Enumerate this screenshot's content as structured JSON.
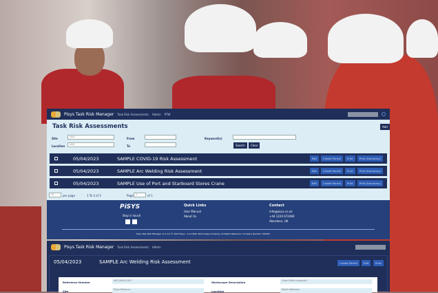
{
  "app": {
    "name": "Pisys Task Risk Manager",
    "nav": [
      "Task Risk Assessments",
      "Admin",
      "PTW"
    ]
  },
  "list": {
    "title": "Task Risk Assessments",
    "add": "Add",
    "filters": {
      "site_label": "Site",
      "site_value": "(All)",
      "location_label": "Location",
      "location_value": "(All)",
      "from_label": "From",
      "to_label": "To",
      "keywords_label": "Keyword(s)",
      "search": "Search",
      "clear": "Clear"
    },
    "rows": [
      {
        "date": "05/04/2023",
        "title": "SAMPLE COVID-19 Risk Assessment"
      },
      {
        "date": "05/04/2023",
        "title": "SAMPLE Arc Welding Risk Assessment"
      },
      {
        "date": "05/04/2023",
        "title": "SAMPLE Use of Port and Starboard Stores Crane"
      }
    ],
    "row_actions": [
      "Edit",
      "Create Permit",
      "Print",
      "Print (Summary)"
    ],
    "pager": {
      "per_page": "10",
      "per_page_label": "per page",
      "range": "1 To 3 of 3",
      "page_label": "Page",
      "page": "1",
      "of": "of 1"
    }
  },
  "footer": {
    "logo": "PiSYS",
    "stay": "Stay in touch",
    "quick_title": "Quick Links",
    "links": [
      "User Manual",
      "About Us"
    ],
    "contact_title": "Contact",
    "email": "info@pisys.co.uk",
    "phone": "+44 1224 672460",
    "address": "Aberdeen, UK",
    "copyright": "Pisys Task Risk Manager v1.2.3.2 © 2023 Pisys - A Scottish Technology Company. All Rights Reserved. Company Number 109490"
  },
  "detail": {
    "nav": [
      "Task Risk Assessments",
      "Admin"
    ],
    "date": "05/04/2023",
    "title": "SAMPLE Arc Welding Risk Assessment",
    "actions": [
      "Create Permit",
      "Edit",
      "Print"
    ],
    "fields": [
      {
        "label": "Reference Number",
        "value": "ARC-WELD-001"
      },
      {
        "label": "Workscope Description",
        "value": "Guard Rails supports"
      },
      {
        "label": "Site",
        "value": "Pisys Minerva"
      },
      {
        "label": "Location",
        "value": "North Walkway"
      }
    ]
  }
}
